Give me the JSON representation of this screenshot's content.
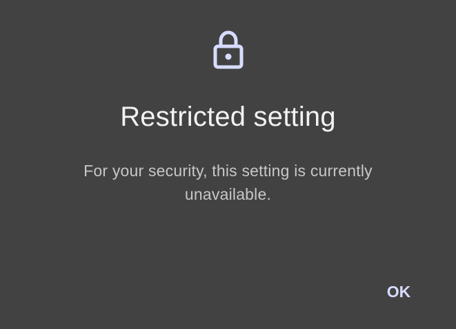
{
  "dialog": {
    "icon": "lock-icon",
    "title": "Restricted setting",
    "message": "For your security, this setting is currently unavailable.",
    "confirm_label": "OK"
  },
  "colors": {
    "background": "#424242",
    "title": "#f2f2f2",
    "message": "#c7c7c7",
    "accent": "#d7dcff"
  }
}
